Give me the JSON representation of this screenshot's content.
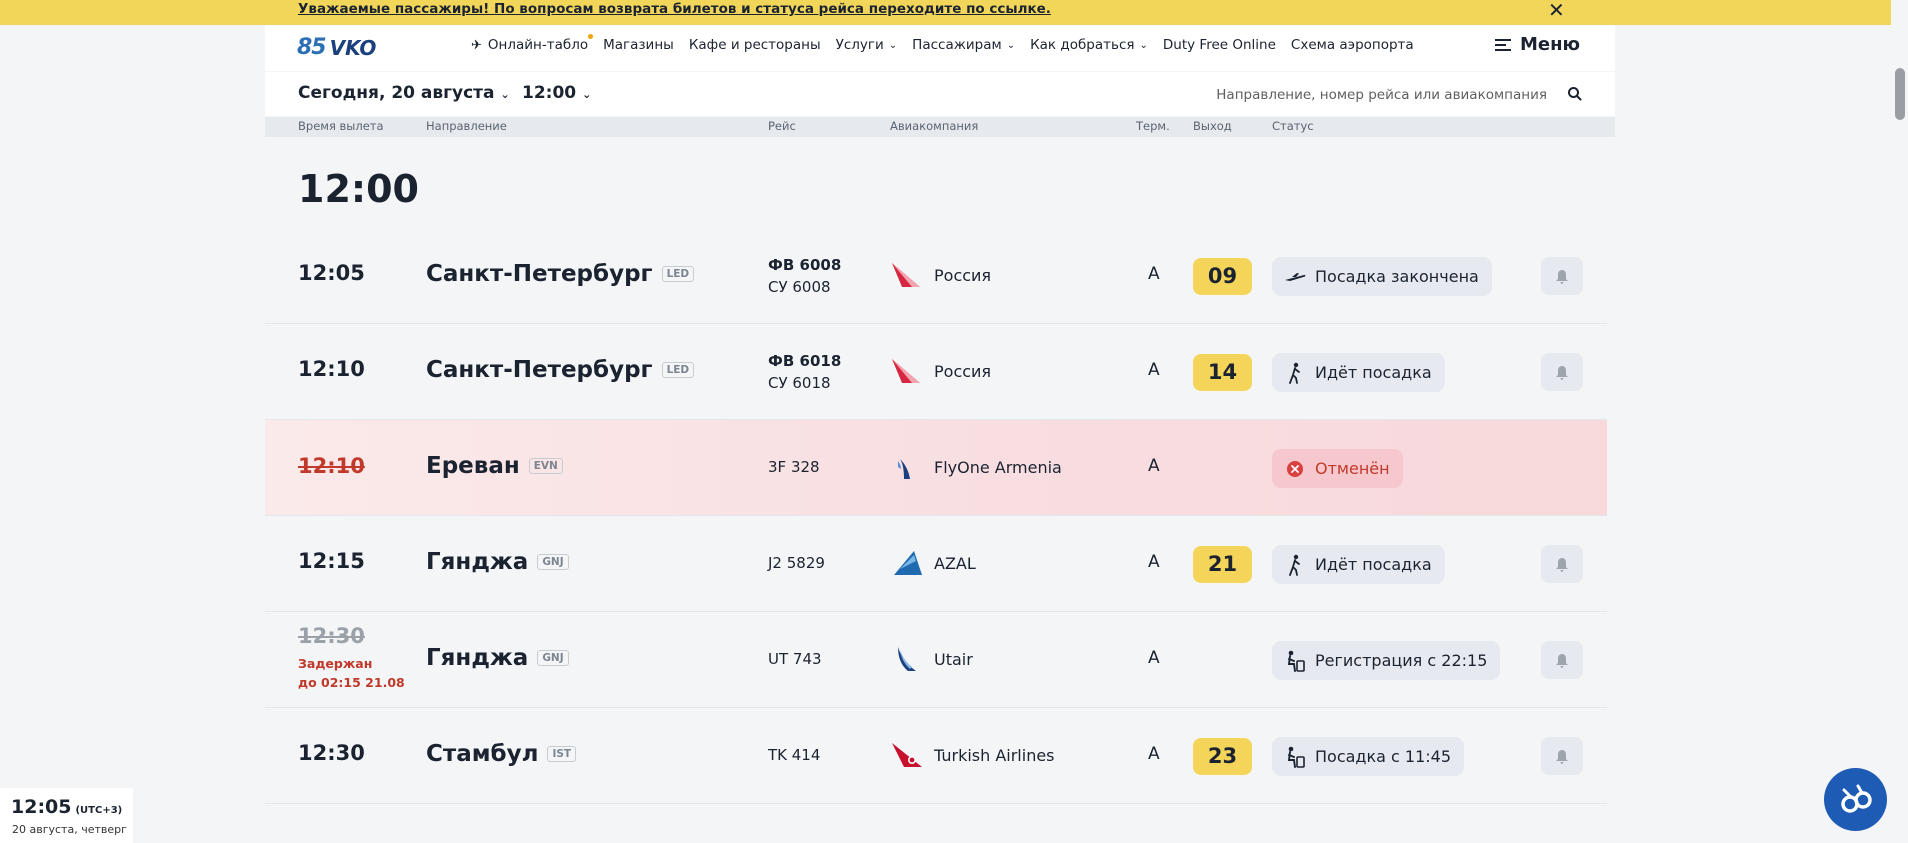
{
  "banner": {
    "text": "Уважаемые пассажиры! По вопросам возврата билетов и статуса рейса переходите по ссылке.",
    "close_icon": "close-icon"
  },
  "header": {
    "logo_number": "85",
    "logo_text": "VKO",
    "nav": [
      {
        "label": "Онлайн-табло",
        "icon": "plane-icon"
      },
      {
        "label": "Магазины"
      },
      {
        "label": "Кафе и рестораны"
      },
      {
        "label": "Услуги",
        "dropdown": true
      },
      {
        "label": "Пассажирам",
        "dropdown": true
      },
      {
        "label": "Как добраться",
        "dropdown": true
      },
      {
        "label": "Duty Free Online"
      },
      {
        "label": "Схема аэропорта"
      }
    ],
    "menu_label": "Меню"
  },
  "filter": {
    "date": "Сегодня, 20 августа",
    "time": "12:00",
    "search_placeholder": "Направление, номер рейса или авиакомпания"
  },
  "columns": {
    "time": "Время вылета",
    "destination": "Направление",
    "flight": "Рейс",
    "airline": "Авиакомпания",
    "terminal": "Терм.",
    "gate": "Выход",
    "status": "Статус"
  },
  "hour_group": "12:00",
  "flights": [
    {
      "time": "12:05",
      "destination": "Санкт-Петербург",
      "code": "LED",
      "flight_primary": "ФВ 6008",
      "flight_secondary": "СУ 6008",
      "airline": "Россия",
      "terminal": "A",
      "gate": "09",
      "status": "Посадка закончена",
      "status_icon": "plane-departed-icon"
    },
    {
      "time": "12:10",
      "destination": "Санкт-Петербург",
      "code": "LED",
      "flight_primary": "ФВ 6018",
      "flight_secondary": "СУ 6018",
      "airline": "Россия",
      "terminal": "A",
      "gate": "14",
      "status": "Идёт посадка",
      "status_icon": "walking-person-icon"
    },
    {
      "time": "12:10",
      "destination": "Ереван",
      "code": "EVN",
      "flight_primary": "3F 328",
      "airline": "FlyOne Armenia",
      "terminal": "A",
      "gate": "",
      "status": "Отменён",
      "status_icon": "cancel-icon",
      "cancelled": true
    },
    {
      "time": "12:15",
      "destination": "Гянджа",
      "code": "GNJ",
      "flight_primary": "J2 5829",
      "airline": "AZAL",
      "terminal": "A",
      "gate": "21",
      "status": "Идёт посадка",
      "status_icon": "walking-person-icon"
    },
    {
      "time": "12:30",
      "destination": "Гянджа",
      "code": "GNJ",
      "flight_primary": "UT 743",
      "airline": "Utair",
      "terminal": "A",
      "gate": "",
      "status": "Регистрация с 22:15",
      "status_icon": "check-in-desk-icon",
      "delay_line1": "Задержан",
      "delay_line2": "до 02:15 21.08"
    },
    {
      "time": "12:30",
      "destination": "Стамбул",
      "code": "IST",
      "flight_primary": "TK 414",
      "airline": "Turkish Airlines",
      "terminal": "A",
      "gate": "23",
      "status": "Посадка с 11:45",
      "status_icon": "check-in-desk-icon"
    }
  ],
  "clock": {
    "time": "12:05",
    "tz": "(UTC+3)",
    "date": "20 августа, четверг"
  },
  "colors": {
    "banner": "#f2d65a",
    "gate": "#f4d55a",
    "cancel_red": "#c0392b",
    "brand_blue": "#1d5bb5"
  }
}
